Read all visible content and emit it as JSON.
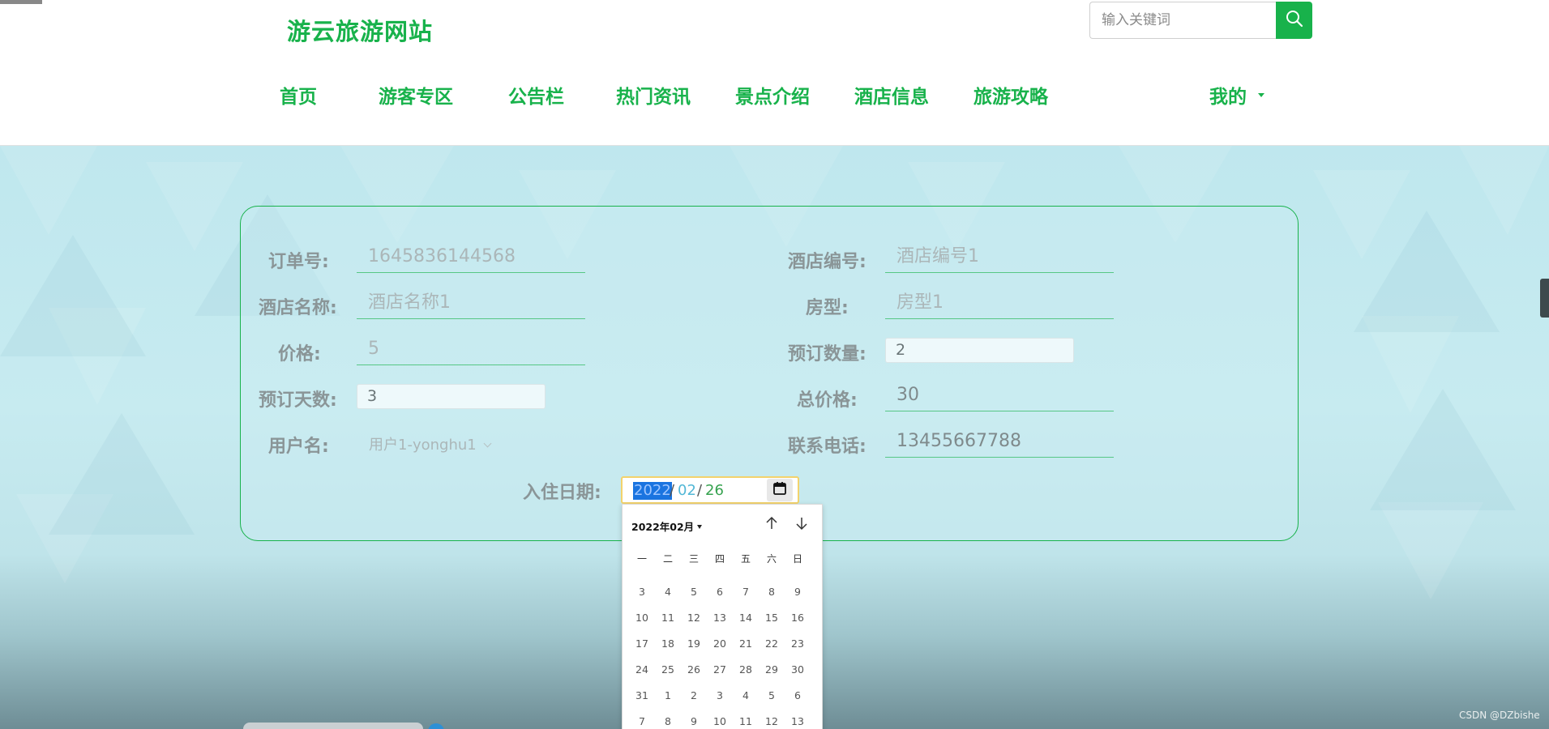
{
  "site": {
    "logo": "游云旅游网站"
  },
  "search": {
    "placeholder": "输入关键词",
    "icon": "search-icon"
  },
  "nav": {
    "items": [
      {
        "label": "首页"
      },
      {
        "label": "游客专区"
      },
      {
        "label": "公告栏"
      },
      {
        "label": "热门资讯"
      },
      {
        "label": "景点介绍"
      },
      {
        "label": "酒店信息"
      },
      {
        "label": "旅游攻略"
      }
    ],
    "account": {
      "label": "我的"
    }
  },
  "form": {
    "order_no": {
      "label": "订单号:",
      "value": "1645836144568"
    },
    "hotel_no": {
      "label": "酒店编号:",
      "value": "酒店编号1"
    },
    "hotel_name": {
      "label": "酒店名称:",
      "value": "酒店名称1"
    },
    "room_type": {
      "label": "房型:",
      "value": "房型1"
    },
    "price": {
      "label": "价格:",
      "value": "5"
    },
    "quantity": {
      "label": "预订数量:",
      "value": "2"
    },
    "days": {
      "label": "预订天数:",
      "value": "3"
    },
    "total": {
      "label": "总价格:",
      "value": "30"
    },
    "username": {
      "label": "用户名:",
      "value": "用户1-yonghu1"
    },
    "phone": {
      "label": "联系电话:",
      "value": "13455667788"
    },
    "checkin": {
      "label": "入住日期:",
      "year": "2022",
      "month": "02",
      "day": "26",
      "sep": "/"
    }
  },
  "calendar": {
    "month_label": "2022年02月",
    "weekdays": [
      "一",
      "二",
      "三",
      "四",
      "五",
      "六",
      "日"
    ],
    "weeks": [
      [
        "3",
        "4",
        "5",
        "6",
        "7",
        "8",
        "9"
      ],
      [
        "10",
        "11",
        "12",
        "13",
        "14",
        "15",
        "16"
      ],
      [
        "17",
        "18",
        "19",
        "20",
        "21",
        "22",
        "23"
      ],
      [
        "24",
        "25",
        "26",
        "27",
        "28",
        "29",
        "30"
      ],
      [
        "31",
        "1",
        "2",
        "3",
        "4",
        "5",
        "6"
      ],
      [
        "7",
        "8",
        "9",
        "10",
        "11",
        "12",
        "13"
      ]
    ]
  },
  "watermark": "CSDN @DZbishe",
  "colors": {
    "brand": "#18b24b",
    "date_focus": "#f3d36c",
    "selection": "#1a74e0"
  }
}
